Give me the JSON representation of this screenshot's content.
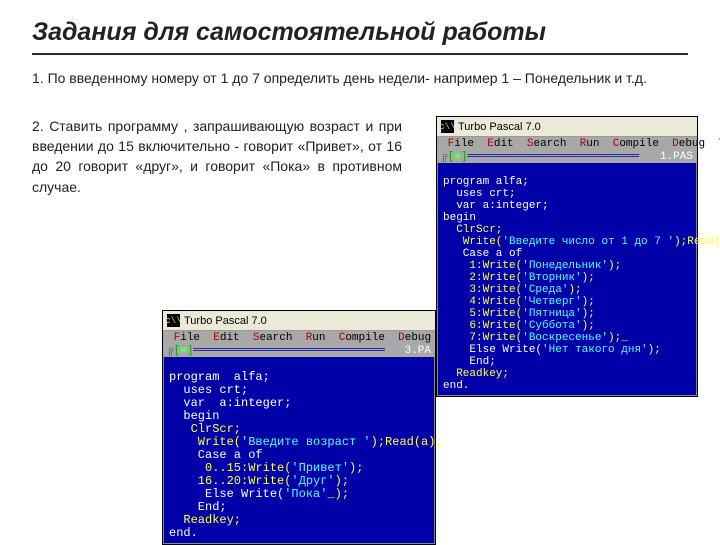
{
  "title": "Задания для самостоятельной работы",
  "task1": "1. По  введенному  номеру  от  1  до  7   определить  день  недели-   например  1 – Понедельник  и  т.д.",
  "task2": "2.  Ставить   программу ,   запрашивающую  возраст  и  при  введении до  15 включительно - говорит «Привет»,  от  16  до  20  говорит  «друг», и говорит «Пока» в  противном  случае.",
  "tp": {
    "title": "Turbo Pascal 7.0",
    "menu": [
      "File",
      "Edit",
      "Search",
      "Run",
      "Compile",
      "Debug",
      "Tools"
    ],
    "menu_short": [
      "File",
      "Edit",
      "Search",
      "Run",
      "Compile",
      "Debug"
    ]
  },
  "right_file": "1.PAS",
  "left_file": "3.PA",
  "code_right": {
    "l1": "program alfa;",
    "l2": "  uses crt;",
    "l3": "  var a:integer;",
    "l4": "begin",
    "l5": "  ClrScr;",
    "l6a": "   Write(",
    "l6b": "'Введите число от 1 до 7 '",
    "l6c": ");Read(a);",
    "l7": "   Case a of",
    "l8a": "    1:Write(",
    "l8b": "'Понедельник'",
    "l8c": ");",
    "l9a": "    2:Write(",
    "l9b": "'Вторник'",
    "l9c": ");",
    "l10a": "    3:Write(",
    "l10b": "'Среда'",
    "l10c": ");",
    "l11a": "    4:Write(",
    "l11b": "'Четверг'",
    "l11c": ");",
    "l12a": "    5:Write(",
    "l12b": "'Пятница'",
    "l12c": ");",
    "l13a": "    6:Write(",
    "l13b": "'Суббота'",
    "l13c": ");",
    "l14a": "    7:Write(",
    "l14b": "'Воскресенье'",
    "l14c": ");_",
    "l15a": "    Else Write(",
    "l15b": "'Нет такого дня'",
    "l15c": ");",
    "l16": "    End;",
    "l17": "  Readkey;",
    "l18": "end."
  },
  "code_left": {
    "l1": "program  alfa;",
    "l2": "  uses crt;",
    "l3": "  var  a:integer;",
    "l4": "  begin",
    "l5": "   ClrScr;",
    "l6a": "    Write(",
    "l6b": "'Введите возраст '",
    "l6c": ");Read(a);",
    "l7": "    Case a of",
    "l8a": "     0..15:Write(",
    "l8b": "'Привет'",
    "l8c": ");",
    "l9a": "    16..20:Write(",
    "l9b": "'Друг'",
    "l9c": ");",
    "l10a": "     Else Write(",
    "l10b": "'Пока'",
    "l10c": "_);",
    "l11": "    End;",
    "l12": "  Readkey;",
    "l13": "end."
  }
}
